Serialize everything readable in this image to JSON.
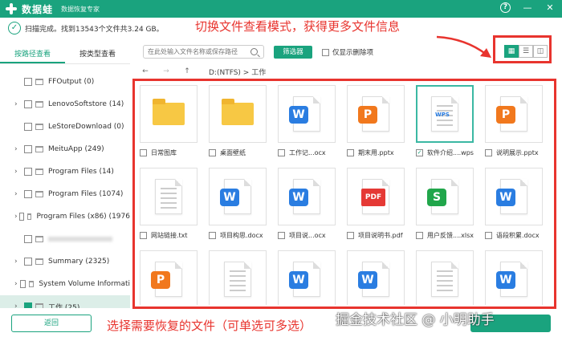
{
  "app": {
    "name": "数据蛙",
    "subtitle": "数据恢复专家"
  },
  "window_controls": {
    "help": "?",
    "minimize": "—",
    "close": "✕"
  },
  "status": {
    "text": "扫描完成。找到13543个文件共3.24 GB。"
  },
  "annotations": {
    "top": "切换文件查看模式，获得更多文件信息",
    "bottom": "选择需要恢复的文件（可单选可多选）"
  },
  "sidebar": {
    "tabs": [
      {
        "label": "按路径查看"
      },
      {
        "label": "按类型查看"
      }
    ],
    "items": [
      {
        "label": "FFOutput (0)",
        "expandable": false
      },
      {
        "label": "LenovoSoftstore (14)",
        "expandable": true
      },
      {
        "label": "LeStoreDownload (0)",
        "expandable": false
      },
      {
        "label": "MeituApp (249)",
        "expandable": true
      },
      {
        "label": "Program Files (14)",
        "expandable": true
      },
      {
        "label": "Program Files (1074)",
        "expandable": true
      },
      {
        "label": "Program Files (x86) (1976",
        "expandable": true
      },
      {
        "label": "",
        "expandable": false
      },
      {
        "label": "Summary (2325)",
        "expandable": true
      },
      {
        "label": "System Volume Informati",
        "expandable": true
      },
      {
        "label": "工作 (25)",
        "expandable": true
      }
    ]
  },
  "toolbar": {
    "search_placeholder": "在此处输入文件名称或保存路径",
    "filter_label": "筛选器",
    "only_deleted_label": "仅显示删除项",
    "view_modes": [
      "▦",
      "☰",
      "◫"
    ]
  },
  "pathbar": {
    "back": "←",
    "forward": "→",
    "up": "↑",
    "path": "D:(NTFS) > 工作"
  },
  "files": [
    {
      "name": "日常图库",
      "type": "folder",
      "checked": false
    },
    {
      "name": "桌面壁纸",
      "type": "folder",
      "checked": false
    },
    {
      "name": "工作记...ocx",
      "type": "word",
      "checked": false
    },
    {
      "name": "期末用.pptx",
      "type": "ppt",
      "checked": false
    },
    {
      "name": "软件介绍....wps",
      "type": "wps",
      "checked": true
    },
    {
      "name": "说明展示.pptx",
      "type": "ppt",
      "checked": false
    },
    {
      "name": "网站链接.txt",
      "type": "txt",
      "checked": false
    },
    {
      "name": "项目构思.docx",
      "type": "word",
      "checked": false
    },
    {
      "name": "项目说...ocx",
      "type": "word",
      "checked": false
    },
    {
      "name": "项目说明书.pdf",
      "type": "pdf",
      "checked": false
    },
    {
      "name": "用户反馈....xlsx",
      "type": "xls",
      "checked": false
    },
    {
      "name": "语段积累.docx",
      "type": "word",
      "checked": false
    },
    {
      "name": "",
      "type": "ppt",
      "checked": false
    },
    {
      "name": "",
      "type": "txt",
      "checked": false
    },
    {
      "name": "",
      "type": "word",
      "checked": false
    },
    {
      "name": "",
      "type": "word",
      "checked": false
    },
    {
      "name": "",
      "type": "txt",
      "checked": false
    },
    {
      "name": "",
      "type": "word",
      "checked": false
    }
  ],
  "bottom": {
    "back_label": "返回",
    "watermark": "掘金技术社区 @ 小明助手"
  },
  "colors": {
    "brand": "#1aa37e",
    "annotation": "#e8342e"
  }
}
